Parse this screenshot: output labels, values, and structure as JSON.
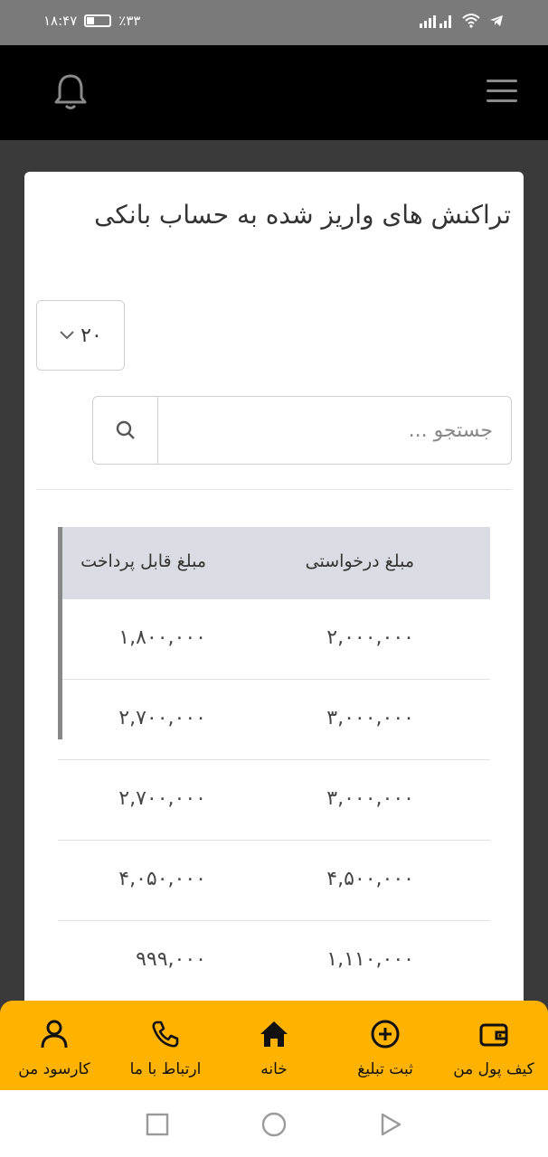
{
  "status": {
    "time": "۱۸:۴۷",
    "battery": "٪۳۳"
  },
  "title": "تراکنش های واریز شده به حساب بانکی",
  "page_size": {
    "value": "۲۰"
  },
  "search": {
    "placeholder": "جستجو ..."
  },
  "table": {
    "headers": [
      "مبلغ درخواستی",
      "مبلغ قابل پرداخت"
    ],
    "rows": [
      [
        "۲,۰۰۰,۰۰۰",
        "۱,۸۰۰,۰۰۰"
      ],
      [
        "۳,۰۰۰,۰۰۰",
        "۲,۷۰۰,۰۰۰"
      ],
      [
        "۳,۰۰۰,۰۰۰",
        "۲,۷۰۰,۰۰۰"
      ],
      [
        "۴,۵۰۰,۰۰۰",
        "۴,۰۵۰,۰۰۰"
      ],
      [
        "۱,۱۱۰,۰۰۰",
        "۹۹۹,۰۰۰"
      ]
    ]
  },
  "bottom_nav": {
    "items": [
      {
        "label": "کیف پول من",
        "icon": "wallet-icon"
      },
      {
        "label": "ثبت تبلیغ",
        "icon": "plus-circle-icon"
      },
      {
        "label": "خانه",
        "icon": "home-icon"
      },
      {
        "label": "ارتباط با ما",
        "icon": "phone-icon"
      },
      {
        "label": "کارسود من",
        "icon": "user-icon"
      }
    ]
  },
  "colors": {
    "accent": "#ffb300",
    "header_bg": "#000000",
    "table_header_bg": "#d9dce2"
  }
}
